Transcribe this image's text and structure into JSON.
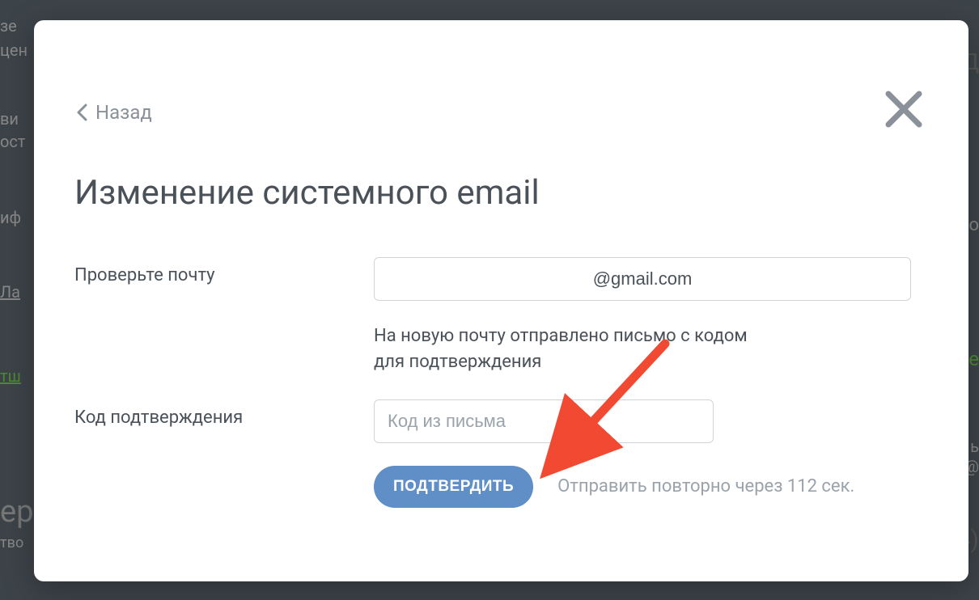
{
  "modal": {
    "back_label": "Назад",
    "title": "Изменение системного email",
    "check_email_label": "Проверьте почту",
    "email_value": "@gmail.com",
    "info_text_line1": "На новую почту отправлено письмо с кодом",
    "info_text_line2": "для подтверждения",
    "code_label": "Код подтверждения",
    "code_placeholder": "Код из письма",
    "confirm_button": "ПОДТВЕРДИТЬ",
    "resend_text": "Отправить повторно через 112 сек."
  }
}
